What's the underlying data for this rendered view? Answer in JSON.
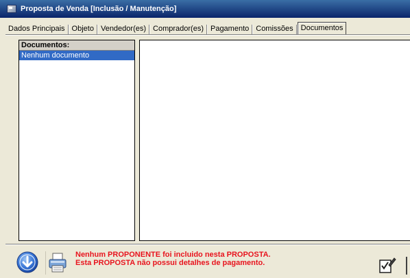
{
  "window": {
    "title": "Proposta de Venda [Inclusão / Manutenção]"
  },
  "tabs": [
    {
      "label": "Dados Principais"
    },
    {
      "label": "Objeto"
    },
    {
      "label": "Vendedor(es)"
    },
    {
      "label": "Comprador(es)"
    },
    {
      "label": "Pagamento"
    },
    {
      "label": "Comissões"
    },
    {
      "label": "Documentos",
      "active": true
    }
  ],
  "documents": {
    "header": "Documentos:",
    "items": [
      "Nenhum documento"
    ]
  },
  "messages": [
    "Nenhum PROPONENTE foi incluido nesta PROPOSTA.",
    "Esta PROPOSTA não possui detalhes de pagamento."
  ],
  "colors": {
    "title_bar": "#0a246a",
    "selection": "#316ac5",
    "message_text": "#e8141e",
    "window_bg": "#ece9d8"
  },
  "icons": {
    "app": "form-icon",
    "down": "arrow-down-circle-icon",
    "print": "printer-icon",
    "confirm": "checklist-pen-icon"
  }
}
